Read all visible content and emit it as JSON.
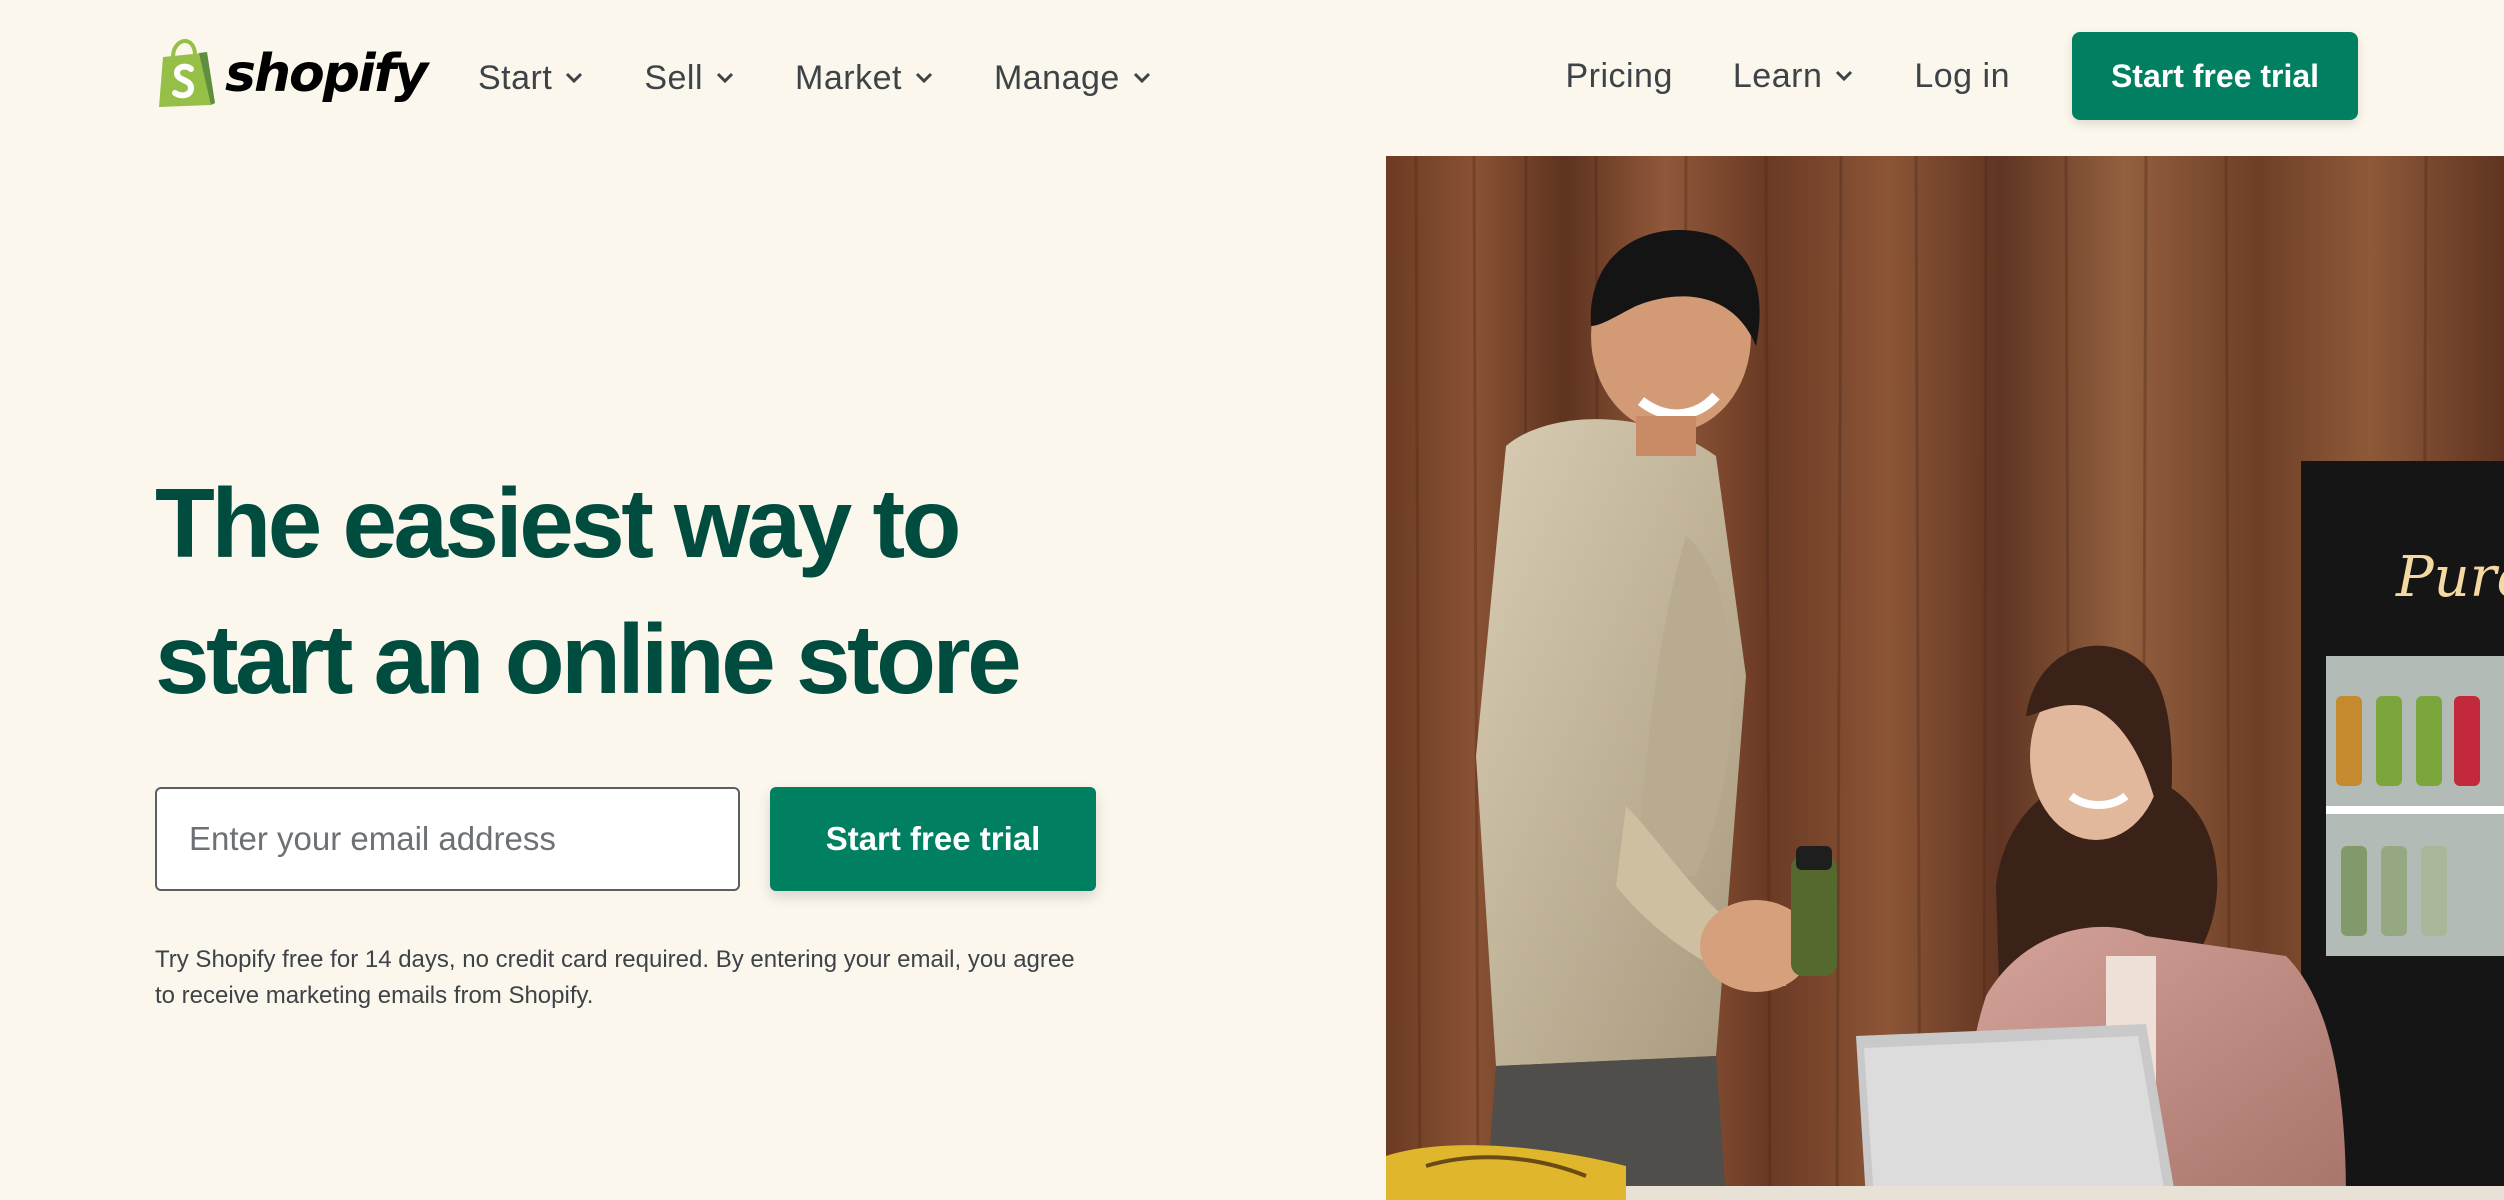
{
  "brand": {
    "name": "shopify",
    "logo_icon": "shopping-bag-icon",
    "green": "#95bf47",
    "dark_green": "#5e8e3e"
  },
  "nav": {
    "left": [
      {
        "label": "Start",
        "icon": "chevron-down-icon"
      },
      {
        "label": "Sell",
        "icon": "chevron-down-icon"
      },
      {
        "label": "Market",
        "icon": "chevron-down-icon"
      },
      {
        "label": "Manage",
        "icon": "chevron-down-icon"
      }
    ],
    "pricing": "Pricing",
    "learn": "Learn",
    "login": "Log in",
    "cta": "Start free trial"
  },
  "hero": {
    "title_line1": "The easiest way to",
    "title_line2": "start an online store",
    "email_placeholder": "Enter your email address",
    "cta": "Start free trial",
    "disclaimer_line1": "Try Shopify free for 14 days, no credit card required. By entering your email, you agree",
    "disclaimer_line2": "to receive marketing emails from Shopify."
  },
  "photo": {
    "sign_text": "Pure"
  },
  "colors": {
    "background": "#fbf7ed",
    "accent": "#008060",
    "heading": "#004c3f",
    "nav_text": "#3e4347"
  }
}
